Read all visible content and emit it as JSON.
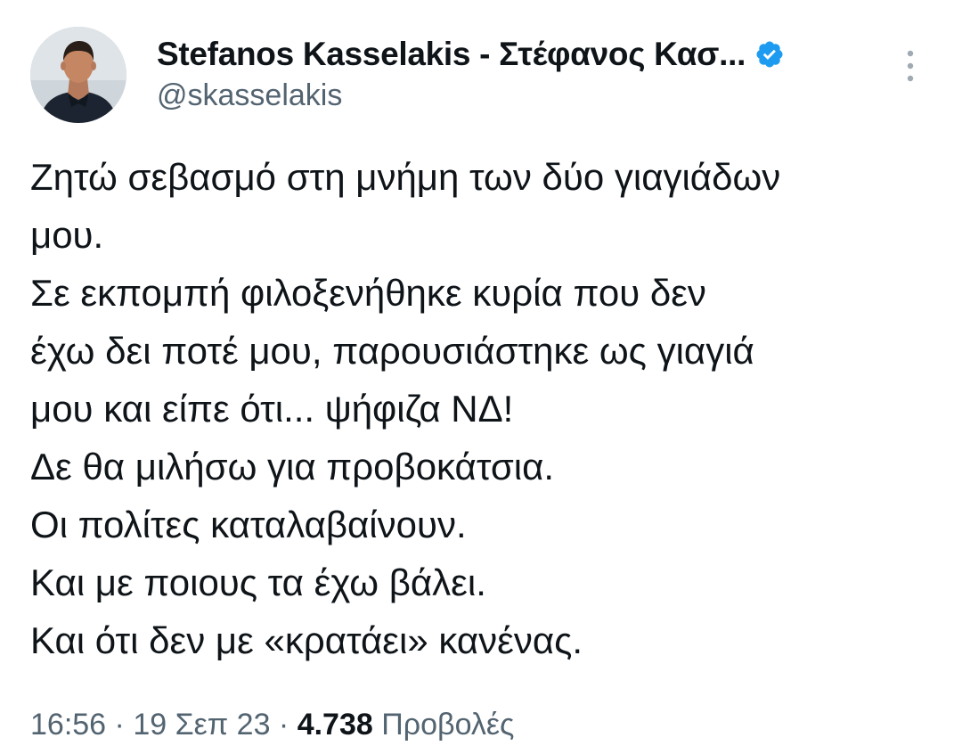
{
  "author": {
    "display_name": "Stefanos Kasselakis - Στέφανος Κασ...",
    "handle": "@skasselakis",
    "verified_icon": "verified-badge-icon",
    "avatar_icon": "avatar"
  },
  "tweet": {
    "lines": [
      "Ζητώ σεβασμό στη μνήμη των δύο γιαγιάδων",
      "μου.",
      "Σε εκπομπή φιλοξενήθηκε κυρία που δεν",
      "έχω δει ποτέ μου, παρουσιάστηκε ως γιαγιά",
      "μου και είπε ότι... ψήφιζα ΝΔ!",
      "Δε θα μιλήσω για προβοκάτσια.",
      "Οι πολίτες καταλαβαίνουν.",
      "Και με ποιους τα έχω βάλει.",
      "Και ότι δεν με «κρατάει» κανένας."
    ]
  },
  "meta": {
    "time": "16:56",
    "separator": " · ",
    "date": "19 Σεπ 23",
    "views_count": "4.738",
    "views_label": "Προβολές"
  },
  "more_icon": "more-vertical-icon",
  "colors": {
    "text": "#0f1419",
    "secondary": "#536471",
    "verified": "#1d9bf0"
  }
}
